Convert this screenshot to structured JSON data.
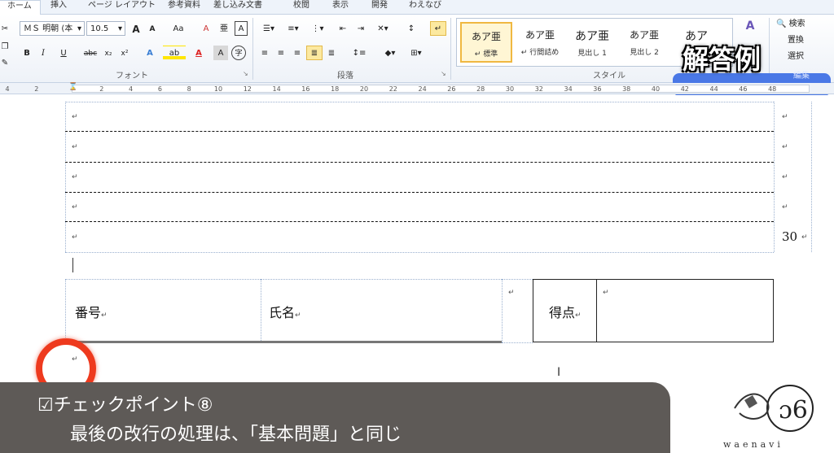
{
  "tabs": [
    {
      "label": "ホーム"
    },
    {
      "label": "挿入"
    },
    {
      "label": "ページ レイアウト"
    },
    {
      "label": "参考資料"
    },
    {
      "label": "差し込み文書"
    },
    {
      "label": "校閲"
    },
    {
      "label": "表示"
    },
    {
      "label": "開発"
    },
    {
      "label": "わえなび"
    }
  ],
  "font": {
    "name": "ＭＳ 明朝 (本",
    "size": "10.5",
    "group_label": "フォント",
    "bold": "B",
    "italic": "I",
    "underline": "U",
    "strike": "abc",
    "subscript": "x₂",
    "superscript": "x²",
    "grow": "A",
    "shrink": "A",
    "case": "Aa",
    "clear": "A",
    "ruby": "亜",
    "border_char": "A",
    "text_effect": "A",
    "highlight": "ab",
    "font_color": "A",
    "shading": "A",
    "enclose": "字"
  },
  "paragraph": {
    "group_label": "段落"
  },
  "styles": {
    "group_label": "スタイル",
    "items": [
      {
        "sample": "あア亜",
        "name": "↵ 標準"
      },
      {
        "sample": "あア亜",
        "name": "↵ 行間詰め"
      },
      {
        "sample": "あア亜",
        "name": "見出し 1"
      },
      {
        "sample": "あア亜",
        "name": "見出し 2"
      },
      {
        "sample": "あア",
        "name": ""
      }
    ]
  },
  "editing": {
    "find": "検索",
    "replace": "置換",
    "select": "選択",
    "group_label": "編集"
  },
  "overlay_title": "解答例",
  "ruler": {
    "numbers": [
      "4",
      "2",
      "2",
      "4",
      "6",
      "8",
      "10",
      "12",
      "14",
      "16",
      "18",
      "20",
      "22",
      "24",
      "26",
      "28",
      "30",
      "32",
      "34",
      "36",
      "38",
      "40",
      "42",
      "44",
      "46",
      "48"
    ]
  },
  "document": {
    "row_number": "30",
    "number_label": "番号",
    "name_label": "氏名",
    "score_label": "得点",
    "para_mark": "↵"
  },
  "banner": {
    "line1": "☑チェックポイント⑧",
    "line2": "最後の改行の処理は、「基本問題」と同じ"
  },
  "brand": "waenavi",
  "colors": {
    "accent_red": "#ee3a1e",
    "banner_bg": "#5e5a57",
    "highlight_blue": "#4a78e6",
    "ribbon_bg": "#eef3fa"
  }
}
